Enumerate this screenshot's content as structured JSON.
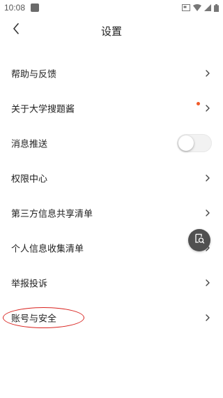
{
  "status_bar": {
    "time": "10:08"
  },
  "header": {
    "title": "设置"
  },
  "settings": [
    {
      "label": "帮助与反馈",
      "control": "chevron"
    },
    {
      "label": "关于大学搜题酱",
      "control": "chevron",
      "badge": "red-dot"
    },
    {
      "label": "消息推送",
      "control": "toggle",
      "toggle_on": false
    },
    {
      "label": "权限中心",
      "control": "chevron"
    },
    {
      "label": "第三方信息共享清单",
      "control": "chevron"
    },
    {
      "label": "个人信息收集清单",
      "control": "chevron"
    },
    {
      "label": "举报投诉",
      "control": "chevron"
    },
    {
      "label": "账号与安全",
      "control": "chevron",
      "highlighted": true
    }
  ],
  "colors": {
    "badge": "#f05a28",
    "annotation": "#d9231f",
    "float_button": "#505050"
  },
  "icons": {
    "back": "chevron-left-icon",
    "row": "chevron-right-icon",
    "float": "screenshot-search-icon"
  }
}
